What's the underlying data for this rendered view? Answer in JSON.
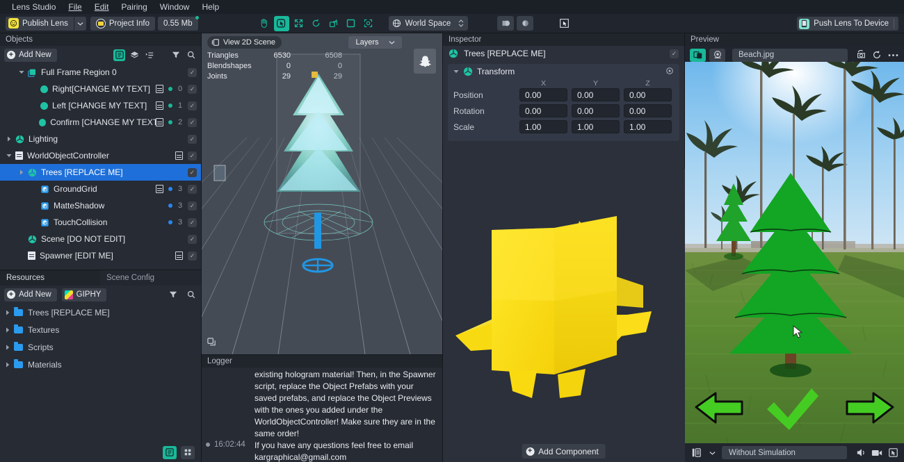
{
  "menu": {
    "items": [
      "Lens Studio",
      "File",
      "Edit",
      "Pairing",
      "Window",
      "Help"
    ]
  },
  "toolbar": {
    "publish_label": "Publish Lens",
    "project_info_label": "Project Info",
    "size_label": "0.55 Mb",
    "tools": [
      {
        "name": "hand-tool",
        "title": "Pan"
      },
      {
        "name": "select-tool",
        "title": "Select"
      },
      {
        "name": "move-tool",
        "title": "Move"
      },
      {
        "name": "rotate-tool",
        "title": "Rotate"
      },
      {
        "name": "scale-tool",
        "title": "Scale"
      },
      {
        "name": "rect-tool",
        "title": "Rect"
      },
      {
        "name": "transform-tool",
        "title": "Transform"
      }
    ],
    "space_label": "World Space",
    "push_lens_label": "Push Lens To Device"
  },
  "objects": {
    "panel_title": "Objects",
    "add_new_label": "Add New",
    "items": [
      {
        "label": "Full Frame Region 0",
        "indent": 1,
        "twist": "down",
        "icon": "frame-icon",
        "script": false,
        "dot": "",
        "num": "",
        "selected": false
      },
      {
        "label": "Right[CHANGE MY TEXT]",
        "indent": 2,
        "twist": "",
        "icon": "ball-teal",
        "script": true,
        "dot": "teal",
        "num": "0",
        "selected": false
      },
      {
        "label": "Left [CHANGE MY TEXT]",
        "indent": 2,
        "twist": "",
        "icon": "ball-teal",
        "script": true,
        "dot": "teal",
        "num": "1",
        "selected": false
      },
      {
        "label": "Confirm [CHANGE MY TEXT]",
        "indent": 2,
        "twist": "",
        "icon": "ball-teal",
        "script": true,
        "dot": "teal",
        "num": "2",
        "selected": false
      },
      {
        "label": "Lighting",
        "indent": 0,
        "twist": "right",
        "icon": "mesh-icon",
        "script": false,
        "dot": "",
        "num": "",
        "selected": false
      },
      {
        "label": "WorldObjectController",
        "indent": 0,
        "twist": "down",
        "icon": "doc-icon",
        "script": true,
        "dot": "",
        "num": "",
        "selected": false
      },
      {
        "label": "Trees [REPLACE ME]",
        "indent": 1,
        "twist": "right",
        "icon": "mesh-icon",
        "script": false,
        "dot": "",
        "num": "",
        "selected": true
      },
      {
        "label": "GroundGrid",
        "indent": 2,
        "twist": "",
        "icon": "cube-blue",
        "script": true,
        "dot": "blue",
        "num": "3",
        "selected": false
      },
      {
        "label": "MatteShadow",
        "indent": 2,
        "twist": "",
        "icon": "cube-blue",
        "script": false,
        "dot": "blue",
        "num": "3",
        "selected": false
      },
      {
        "label": "TouchCollision",
        "indent": 2,
        "twist": "",
        "icon": "cube-blue",
        "script": false,
        "dot": "blue",
        "num": "3",
        "selected": false
      },
      {
        "label": "Scene [DO NOT EDIT]",
        "indent": 1,
        "twist": "",
        "icon": "mesh-icon",
        "script": false,
        "dot": "",
        "num": "",
        "selected": false
      },
      {
        "label": "Spawner [EDIT ME]",
        "indent": 1,
        "twist": "",
        "icon": "doc-icon",
        "script": true,
        "dot": "",
        "num": "",
        "selected": false
      }
    ]
  },
  "resources": {
    "tab_resources": "Resources",
    "tab_scene_config": "Scene Config",
    "add_new_label": "Add New",
    "giphy_label": "GIPHY",
    "folders": [
      "Trees [REPLACE ME]",
      "Textures",
      "Scripts",
      "Materials"
    ]
  },
  "scene": {
    "view_2d_label": "View 2D Scene",
    "layers_label": "Layers",
    "stats": [
      {
        "key": "Triangles",
        "v1": "6530",
        "v2": "6508"
      },
      {
        "key": "Blendshapes",
        "v1": "0",
        "v2": "0"
      },
      {
        "key": "Joints",
        "v1": "29",
        "v2": "29"
      }
    ]
  },
  "logger": {
    "title": "Logger",
    "entries": [
      {
        "bullet": false,
        "time": "",
        "message": "existing hologram material! Then, in the Spawner script, replace the Object Prefabs with your saved prefabs, and replace the Object Previews with the ones you added under the WorldObjectController! Make sure they are in the same order!"
      },
      {
        "bullet": true,
        "time": "16:02:44",
        "message": "If you have any questions feel free to email kargraphical@gmail.com"
      }
    ]
  },
  "inspector": {
    "panel_title": "Inspector",
    "object_name": "Trees [REPLACE ME]",
    "transform": {
      "title": "Transform",
      "columns": [
        "X",
        "Y",
        "Z"
      ],
      "rows": [
        {
          "label": "Position",
          "values": [
            "0.00",
            "0.00",
            "0.00"
          ]
        },
        {
          "label": "Rotation",
          "values": [
            "0.00",
            "0.00",
            "0.00"
          ]
        },
        {
          "label": "Scale",
          "values": [
            "1.00",
            "1.00",
            "1.00"
          ]
        }
      ]
    },
    "add_component_label": "Add Component"
  },
  "preview": {
    "panel_title": "Preview",
    "file_name": "Beach.jpg",
    "simulation_label": "Without Simulation"
  },
  "colors": {
    "accent_teal": "#19b89a",
    "selection_blue": "#1e6fd9",
    "panel_bg": "#272b33",
    "inspector_bg": "#2b303a",
    "viewport_gray": "#454b55",
    "yellow_object": "#f7e023",
    "arrow_green": "#44cc22"
  }
}
